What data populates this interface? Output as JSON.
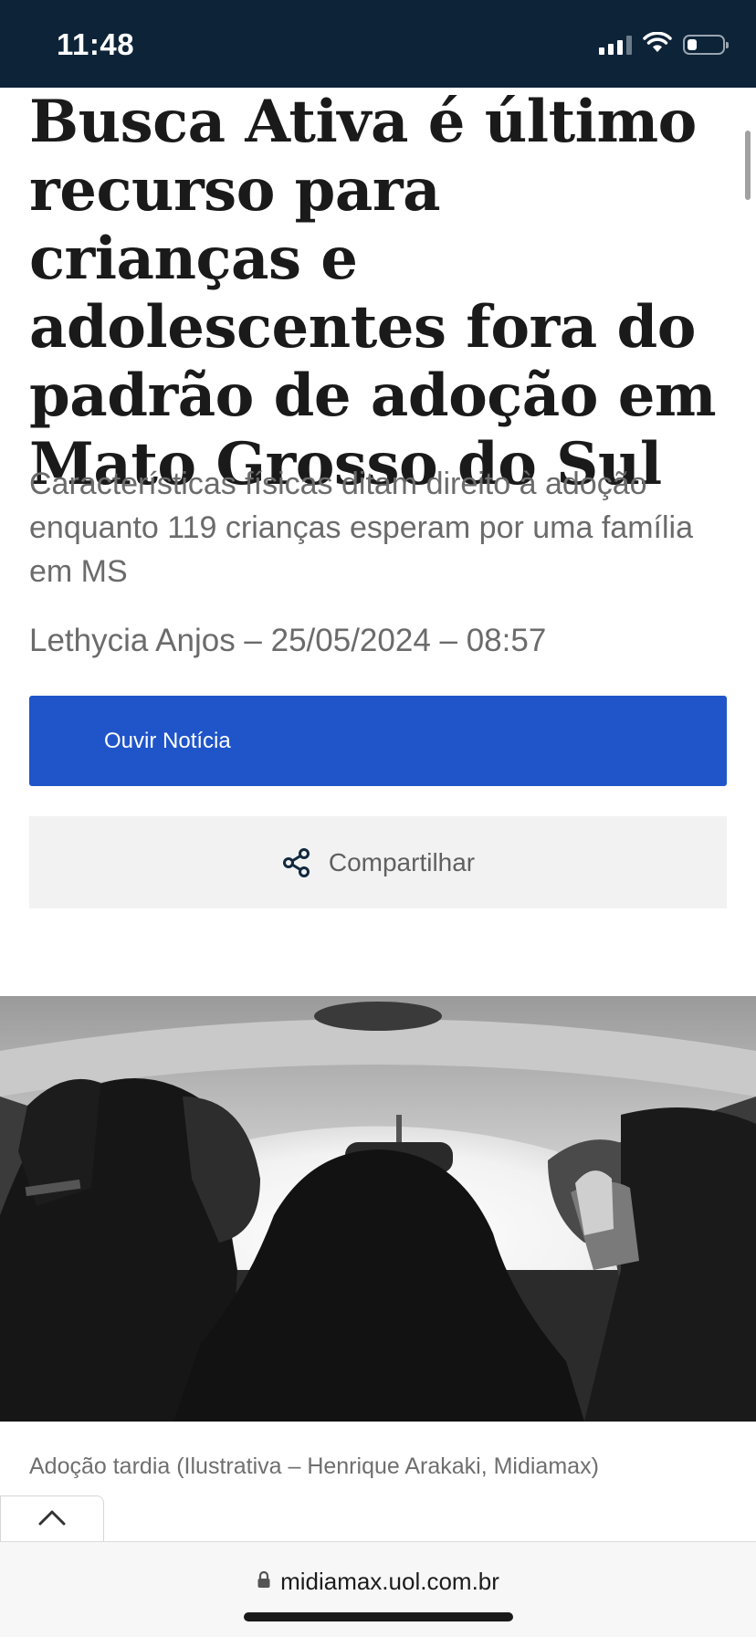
{
  "status_bar": {
    "time": "11:48"
  },
  "article": {
    "headline": "Busca Ativa é último recurso para crianças e adolescentes fora do padrão de adoção em Mato Grosso do Sul",
    "subtitle": "Características físicas ditam direito à adoção enquanto 119 crianças esperam por uma família em MS",
    "byline": "Lethycia Anjos – 25/05/2024 – 08:57",
    "listen_label": "Ouvir Notícia",
    "share_label": "Compartilhar",
    "photo_caption": "Adoção tardia (Ilustrativa – Henrique Arakaki, Midiamax)"
  },
  "browser": {
    "url": "midiamax.uol.com.br"
  },
  "colors": {
    "status_bar_bg": "#0c2338",
    "listen_button_bg": "#1f55c9",
    "share_button_bg": "#f2f2f2"
  },
  "icons": {
    "share": "share-icon",
    "back_to_top": "chevron-up-icon",
    "lock": "lock-icon",
    "signal": "signal-icon",
    "wifi": "wifi-icon",
    "battery": "battery-icon"
  }
}
